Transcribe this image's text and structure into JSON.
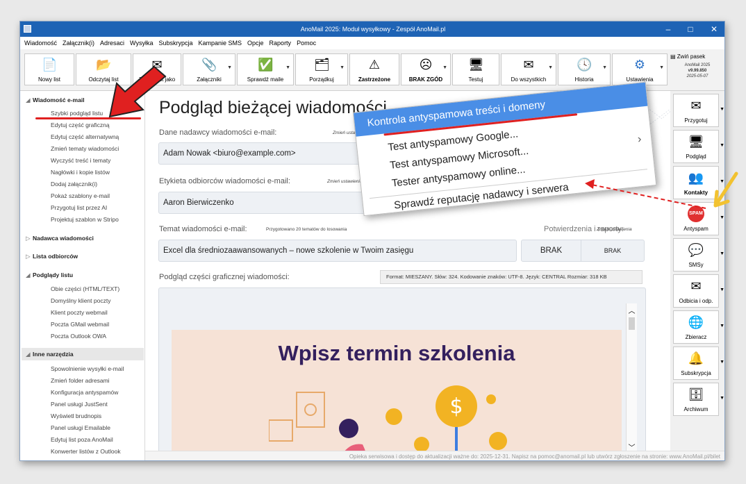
{
  "window": {
    "title": "AnoMail 2025: Moduł wysyłkowy - Zespół AnoMail.pl",
    "minimize": "–",
    "maximize": "□",
    "close": "✕"
  },
  "menu": [
    "Wiadomość",
    "Załącznik(i)",
    "Adresaci",
    "Wysyłka",
    "Subskrypcja",
    "Kampanie SMS",
    "Opcje",
    "Raporty",
    "Pomoc"
  ],
  "toolbar": {
    "buttons": [
      {
        "label": "Nowy list",
        "icon": "new-file-icon",
        "glyph": "📄"
      },
      {
        "label": "Odczytaj list",
        "icon": "folder-open-icon",
        "glyph": "📂"
      },
      {
        "label": "Zapisz list jako",
        "icon": "save-icon",
        "glyph": "✉"
      },
      {
        "label": "Załączniki",
        "icon": "attachment-icon",
        "glyph": "📎"
      },
      {
        "label": "Sprawdź maile",
        "icon": "check-mail-icon",
        "glyph": "✅"
      },
      {
        "label": "Porządkuj",
        "icon": "sort-icon",
        "glyph": "🗂"
      },
      {
        "label": "Zastrzeżone",
        "icon": "warning-icon",
        "glyph": "⚠"
      },
      {
        "label": "BRAK ZGÓD",
        "icon": "no-consent-icon",
        "glyph": "☹"
      },
      {
        "label": "Testuj",
        "icon": "test-icon",
        "glyph": "🖥"
      },
      {
        "label": "Do wszystkich",
        "icon": "send-all-icon",
        "glyph": "✉"
      },
      {
        "label": "Historia",
        "icon": "history-icon",
        "glyph": "🕓"
      },
      {
        "label": "Ustawienia",
        "icon": "gear-icon",
        "glyph": "⚙"
      }
    ],
    "collapse_label": "Zwiń pasek",
    "version_name": "AnoMail 2025",
    "version_number": "v9.99.850",
    "version_date": "2025-05-07"
  },
  "sidebar": {
    "sections": [
      {
        "title": "Wiadomość e-mail",
        "expanded": true,
        "items": [
          "Szybki podgląd listu",
          "Edytuj część graficzną",
          "Edytuj część alternatywną",
          "Zmień tematy wiadomości",
          "Wyczyść treść i tematy",
          "Nagłówki i kopie listów",
          "Dodaj załącznik(i)",
          "Pokaż szablony e-mail",
          "Przygotuj list przez AI",
          "Projektuj szablon w Stripo"
        ]
      },
      {
        "title": "Nadawca wiadomości",
        "expanded": false,
        "items": []
      },
      {
        "title": "Lista odbiorców",
        "expanded": false,
        "items": []
      },
      {
        "title": "Podglądy listu",
        "expanded": true,
        "items": [
          "Obie części (HTML/TEXT)",
          "Domyślny klient poczty",
          "Klient poczty webmail",
          "Poczta GMail webmail",
          "Poczta Outlook OWA"
        ]
      },
      {
        "title": "Inne narzędzia",
        "expanded": true,
        "items": [
          "Spowolnienie wysyłki e-mail",
          "Zmień folder adresami",
          "Konfiguracja antyspamów",
          "Panel usługi JustSent",
          "Wyświetl brudnopis",
          "Panel usługi Emailable",
          "Edytuj list poza AnoMail",
          "Konwerter listów z Outlook"
        ]
      }
    ]
  },
  "main": {
    "title": "Podgląd bieżącej wiadomości",
    "sender_label": "Dane nadawcy wiadomości e-mail:",
    "sender_note": "Zmień ustawienia",
    "sender_value": "Adam Nowak <biuro@example.com>",
    "recipients_label": "Etykieta odbiorców wiadomości e-mail:",
    "recipients_note": "Zmień ustawienia",
    "recipients_value": "Aaron Bierwiczenko",
    "subject_label": "Temat wiadomości e-mail:",
    "subject_note": "Przygotowano 20 tematów do losowania",
    "subject_value": "Excel dla średniozaawansowanych – nowe szkolenie w Twoim zasięgu",
    "reports_label": "Potwierdzenia i raporty:",
    "reports_note": "Zmień ustawienia",
    "report1": "BRAK",
    "report2": "BRAK",
    "preview_label": "Podgląd części graficznej wiadomości:",
    "format_info": "Format: MIESZANY. Słów: 324. Kodowanie znaków: UTF-8. Język: CENTRAL     Rozmiar: 318 KB",
    "preview_heading": "Wpisz termin szkolenia"
  },
  "right_panel": [
    {
      "label": "Przygotuj",
      "icon": "prepare-icon",
      "glyph": "✉"
    },
    {
      "label": "Podgląd",
      "icon": "preview-icon",
      "glyph": "🖥"
    },
    {
      "label": "Kontakty",
      "icon": "contacts-icon",
      "glyph": "👥"
    },
    {
      "label": "Antyspam",
      "icon": "spam-icon",
      "glyph": "SPAM"
    },
    {
      "label": "SMSy",
      "icon": "sms-icon",
      "glyph": "💬"
    },
    {
      "label": "Odbicia i odp.",
      "icon": "bounce-icon",
      "glyph": "✉"
    },
    {
      "label": "Zbieracz",
      "icon": "www-icon",
      "glyph": "🌐"
    },
    {
      "label": "Subskrypcja",
      "icon": "bell-icon",
      "glyph": "🔔"
    },
    {
      "label": "Archiwum",
      "icon": "archive-icon",
      "glyph": "🗄"
    }
  ],
  "popup": {
    "items": [
      "Kontrola antyspamowa treści i domeny",
      "Test antyspamowy Google...",
      "Test antyspamowy Microsoft...",
      "Tester antyspamowy online...",
      "Sprawdź reputację nadawcy i serwera"
    ],
    "submenu_arrow": "›"
  },
  "status": "Opieka serwisowa i dostęp do aktualizacji ważne do: 2025-12-31. Napisz na pomoc@anomail.pl lub utwórz zgłoszenie na stronie: www.AnoMail.pl/bilet",
  "colors": {
    "titlebar": "#1e63b5",
    "highlight": "#4a8ee6",
    "arrow_red": "#e02020",
    "arrow_yellow": "#f2c230",
    "heading": "#34205e"
  }
}
